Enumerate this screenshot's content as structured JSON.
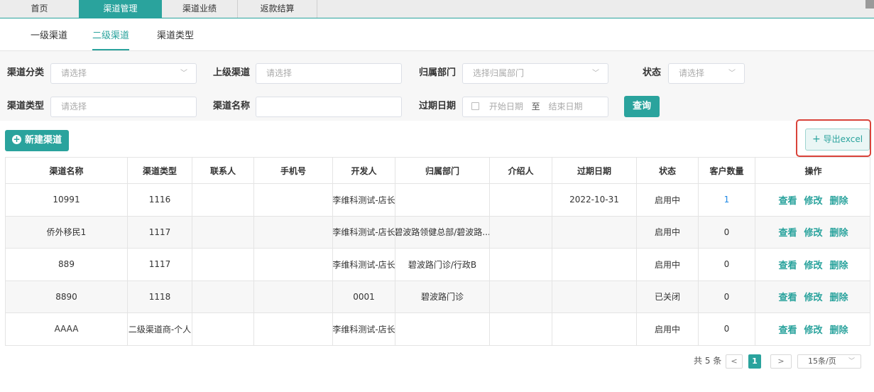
{
  "top_tabs": [
    "首页",
    "渠道管理",
    "渠道业绩",
    "返款结算"
  ],
  "active_top_tab": "渠道管理",
  "sub_tabs": [
    "一级渠道",
    "二级渠道",
    "渠道类型"
  ],
  "active_sub_tab": "二级渠道",
  "filters": {
    "category_label": "渠道分类",
    "category_placeholder": "请选择",
    "parent_label": "上级渠道",
    "parent_placeholder": "请选择",
    "dept_label": "归属部门",
    "dept_placeholder": "选择归属部门",
    "status_label": "状态",
    "status_placeholder": "请选择",
    "type_label": "渠道类型",
    "type_placeholder": "请选择",
    "name_label": "渠道名称",
    "name_value": "",
    "expiry_label": "过期日期",
    "start_placeholder": "开始日期",
    "range_sep": "至",
    "end_placeholder": "结束日期",
    "query_label": "查询"
  },
  "actions": {
    "new_label": "新建渠道",
    "export_label": "导出excel"
  },
  "table": {
    "headers": [
      "渠道名称",
      "渠道类型",
      "联系人",
      "手机号",
      "开发人",
      "归属部门",
      "介绍人",
      "过期日期",
      "状态",
      "客户数量",
      "操作"
    ],
    "rows": [
      {
        "name": "10991",
        "type": "1116",
        "contact": "",
        "phone": "",
        "developer": "李维科测试-店长",
        "dept": "",
        "referrer": "",
        "expiry": "2022-10-31",
        "status": "启用中",
        "customers": "1"
      },
      {
        "name": "侨外移民1",
        "type": "1117",
        "contact": "",
        "phone": "",
        "developer": "李维科测试-店长",
        "dept": "碧波路领健总部/碧波路...",
        "referrer": "",
        "expiry": "",
        "status": "启用中",
        "customers": "0"
      },
      {
        "name": "889",
        "type": "1117",
        "contact": "",
        "phone": "",
        "developer": "李维科测试-店长",
        "dept": "碧波路门诊/行政B",
        "referrer": "",
        "expiry": "",
        "status": "启用中",
        "customers": "0"
      },
      {
        "name": "8890",
        "type": "1118",
        "contact": "",
        "phone": "",
        "developer": "0001",
        "dept": "碧波路门诊",
        "referrer": "",
        "expiry": "",
        "status": "已关闭",
        "customers": "0"
      },
      {
        "name": "AAAA",
        "type": "二级渠道商-个人",
        "contact": "",
        "phone": "",
        "developer": "李维科测试-店长",
        "dept": "",
        "referrer": "",
        "expiry": "",
        "status": "启用中",
        "customers": "0"
      }
    ],
    "ops": [
      "查看",
      "修改",
      "删除"
    ]
  },
  "pagination": {
    "total_text": "共 5 条",
    "current_page": "1",
    "page_size": "15条/页"
  },
  "colors": {
    "accent": "#2aa39d",
    "link": "#1e88e5",
    "highlight": "#d9433a"
  }
}
